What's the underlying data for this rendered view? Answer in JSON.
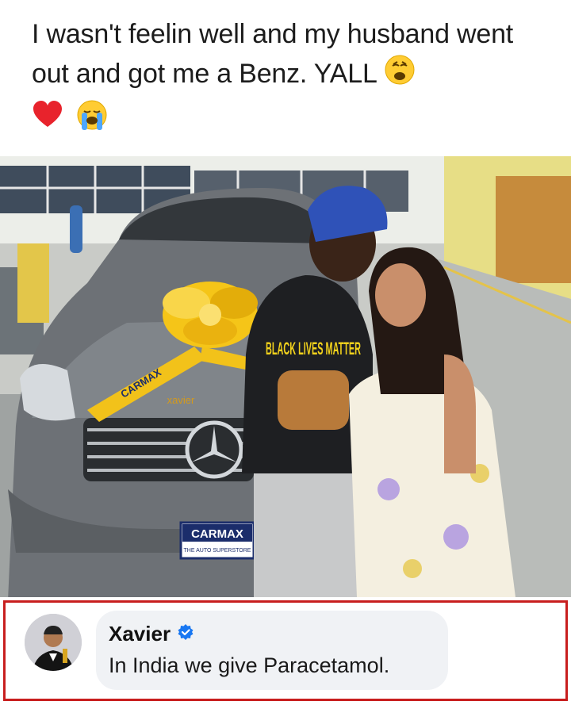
{
  "post": {
    "text": "I wasn't feelin well and my husband went out and got me a Benz. YALL",
    "emojis": [
      "weary-face-emoji",
      "red-heart-emoji",
      "loudly-crying-face-emoji"
    ]
  },
  "photo": {
    "bow_ribbon_text": "CARMAX",
    "watermark": "xavier",
    "plate_brand": "CARMAX",
    "plate_tagline": "THE AUTO SUPERSTORE",
    "shirt_text": "BLACK LIVES MATTER"
  },
  "comment": {
    "author": "Xavier",
    "verified_icon": "verified-badge-icon",
    "text": "In India we give Paracetamol."
  },
  "colors": {
    "frame": "#c81e1e",
    "bubble": "#f0f2f5",
    "verified": "#1877f2",
    "ribbon": "#f5c518"
  }
}
